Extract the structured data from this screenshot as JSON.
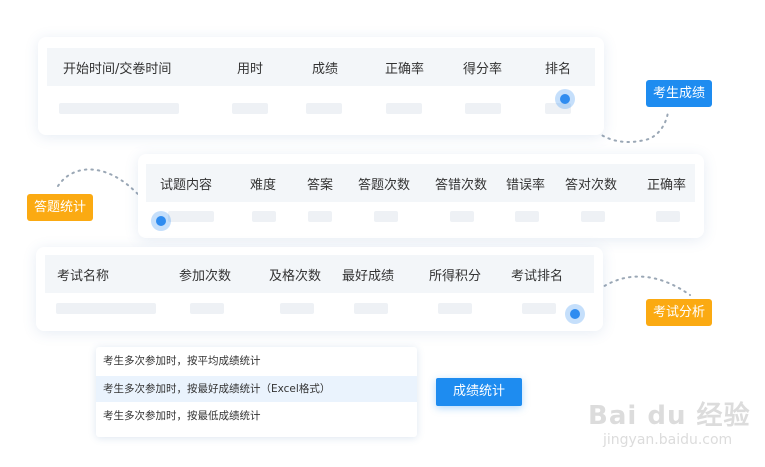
{
  "exam_record": {
    "columns": [
      "开始时间/交卷时间",
      "用时",
      "成绩",
      "正确率",
      "得分率",
      "排名"
    ]
  },
  "question_stats": {
    "columns": [
      "试题内容",
      "难度",
      "答案",
      "答题次数",
      "答错次数",
      "错误率",
      "答对次数",
      "正确率"
    ]
  },
  "exam_summary": {
    "columns": [
      "考试名称",
      "参加次数",
      "及格次数",
      "最好成绩",
      "所得积分",
      "考试排名"
    ]
  },
  "tags": {
    "candidate_score": "考生成绩",
    "question_stats": "答题统计",
    "exam_analysis": "考试分析"
  },
  "menu": {
    "items": [
      "考生多次参加时，按平均成绩统计",
      "考生多次参加时，按最好成绩统计（Excel格式）",
      "考生多次参加时，按最低成绩统计"
    ],
    "active_index": 1
  },
  "score_stats_button": "成绩统计",
  "watermark": {
    "logo": "Bai du 经验",
    "url": "jingyan.baidu.com"
  },
  "colors": {
    "accent_blue": "#1e8cf0",
    "accent_orange": "#fbaa12",
    "header_bg": "#f3f6f9"
  }
}
